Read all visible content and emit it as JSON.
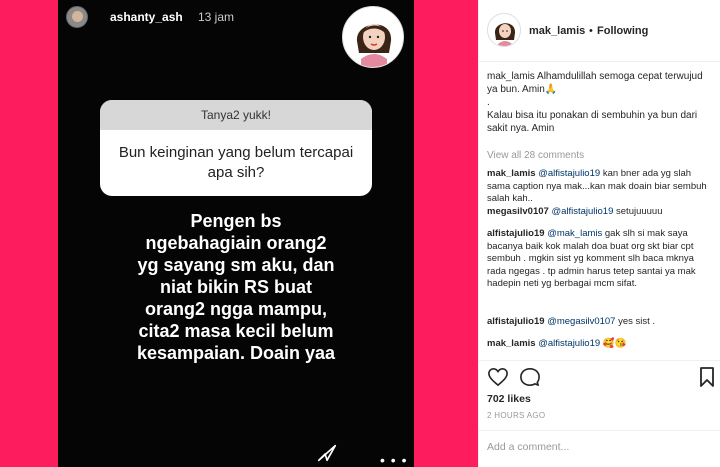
{
  "story": {
    "username": "ashanty_ash",
    "time": "13 jam",
    "question_title": "Tanya2 yukk!",
    "question": "Bun keinginan yang belum tercapai apa sih?",
    "answer": "Pengen bs\nngebahagiain orang2\nyg sayang sm aku, dan\nniat bikin RS buat\norang2 ngga mampu,\ncita2 masa kecil belum\nkesampaian. Doain yaa",
    "dots": "• • •"
  },
  "post": {
    "username": "mak_lamis",
    "dot": "•",
    "follow_status": "Following",
    "caption_user": "mak_lamis",
    "caption_text": "Alhamdulillah semoga cepat terwujud ya bun. Amin🙏",
    "caption_sep": ".",
    "caption_text2": "Kalau bisa itu ponakan di sembuhin ya bun dari sakit nya. Amin",
    "view_all": "View all 28 comments",
    "comments": [
      {
        "user": "mak_lamis",
        "mention": "@alfistajulio19",
        "text": "kan bner ada yg slah sama caption nya mak...kan mak doain biar sembuh salah kah.."
      },
      {
        "user": "megasilv0107",
        "mention": "@alfistajulio19",
        "text": "setujuuuuu"
      },
      {
        "user": "alfistajulio19",
        "mention": "@mak_lamis",
        "text": "gak slh si mak saya bacanya baik kok malah doa buat org skt biar cpt sembuh . mgkin sist yg komment slh baca mknya rada ngegas . tp admin harus tetep santai ya mak hadepin neti yg berbagai mcm sifat."
      },
      {
        "user": "alfistajulio19",
        "mention": "@megasilv0107",
        "text": "yes sist ."
      },
      {
        "user": "mak_lamis",
        "mention": "@alfistajulio19",
        "text": "🥰😘"
      }
    ],
    "likes": "702 likes",
    "time_ago": "2 HOURS AGO",
    "comment_placeholder": "Add a comment..."
  }
}
